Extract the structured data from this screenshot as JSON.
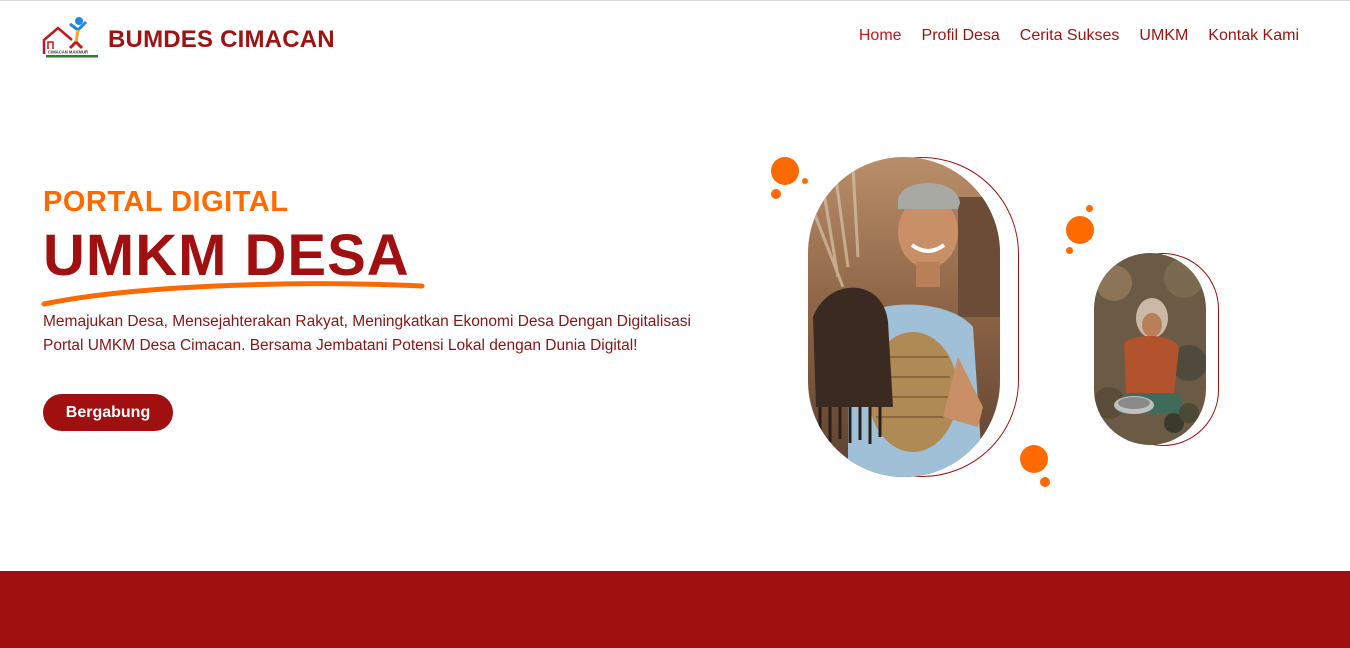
{
  "header": {
    "brand_name": "BUMDES CIMACAN",
    "logo_text": "CIMACAN MAKMUR"
  },
  "nav": {
    "items": [
      {
        "label": "Home",
        "active": true
      },
      {
        "label": "Profil Desa",
        "active": false
      },
      {
        "label": "Cerita Sukses",
        "active": false
      },
      {
        "label": "UMKM",
        "active": false
      },
      {
        "label": "Kontak Kami",
        "active": false
      }
    ]
  },
  "hero": {
    "kicker": "PORTAL DIGITAL",
    "headline": "UMKM DESA",
    "description": "Memajukan Desa, Mensejahterakan Rakyat, Meningkatkan Ekonomi Desa Dengan Digitalisasi Portal UMKM Desa Cimacan. Bersama Jembatani Potensi Lokal dengan Dunia Digital!",
    "cta_label": "Bergabung"
  },
  "colors": {
    "brand_red": "#a11010",
    "accent_orange": "#ff6a00",
    "background": "#ffffff"
  },
  "images": {
    "main_photo": "man-holding-woven-bag-photo",
    "secondary_photo": "woman-market-vendor-photo"
  }
}
